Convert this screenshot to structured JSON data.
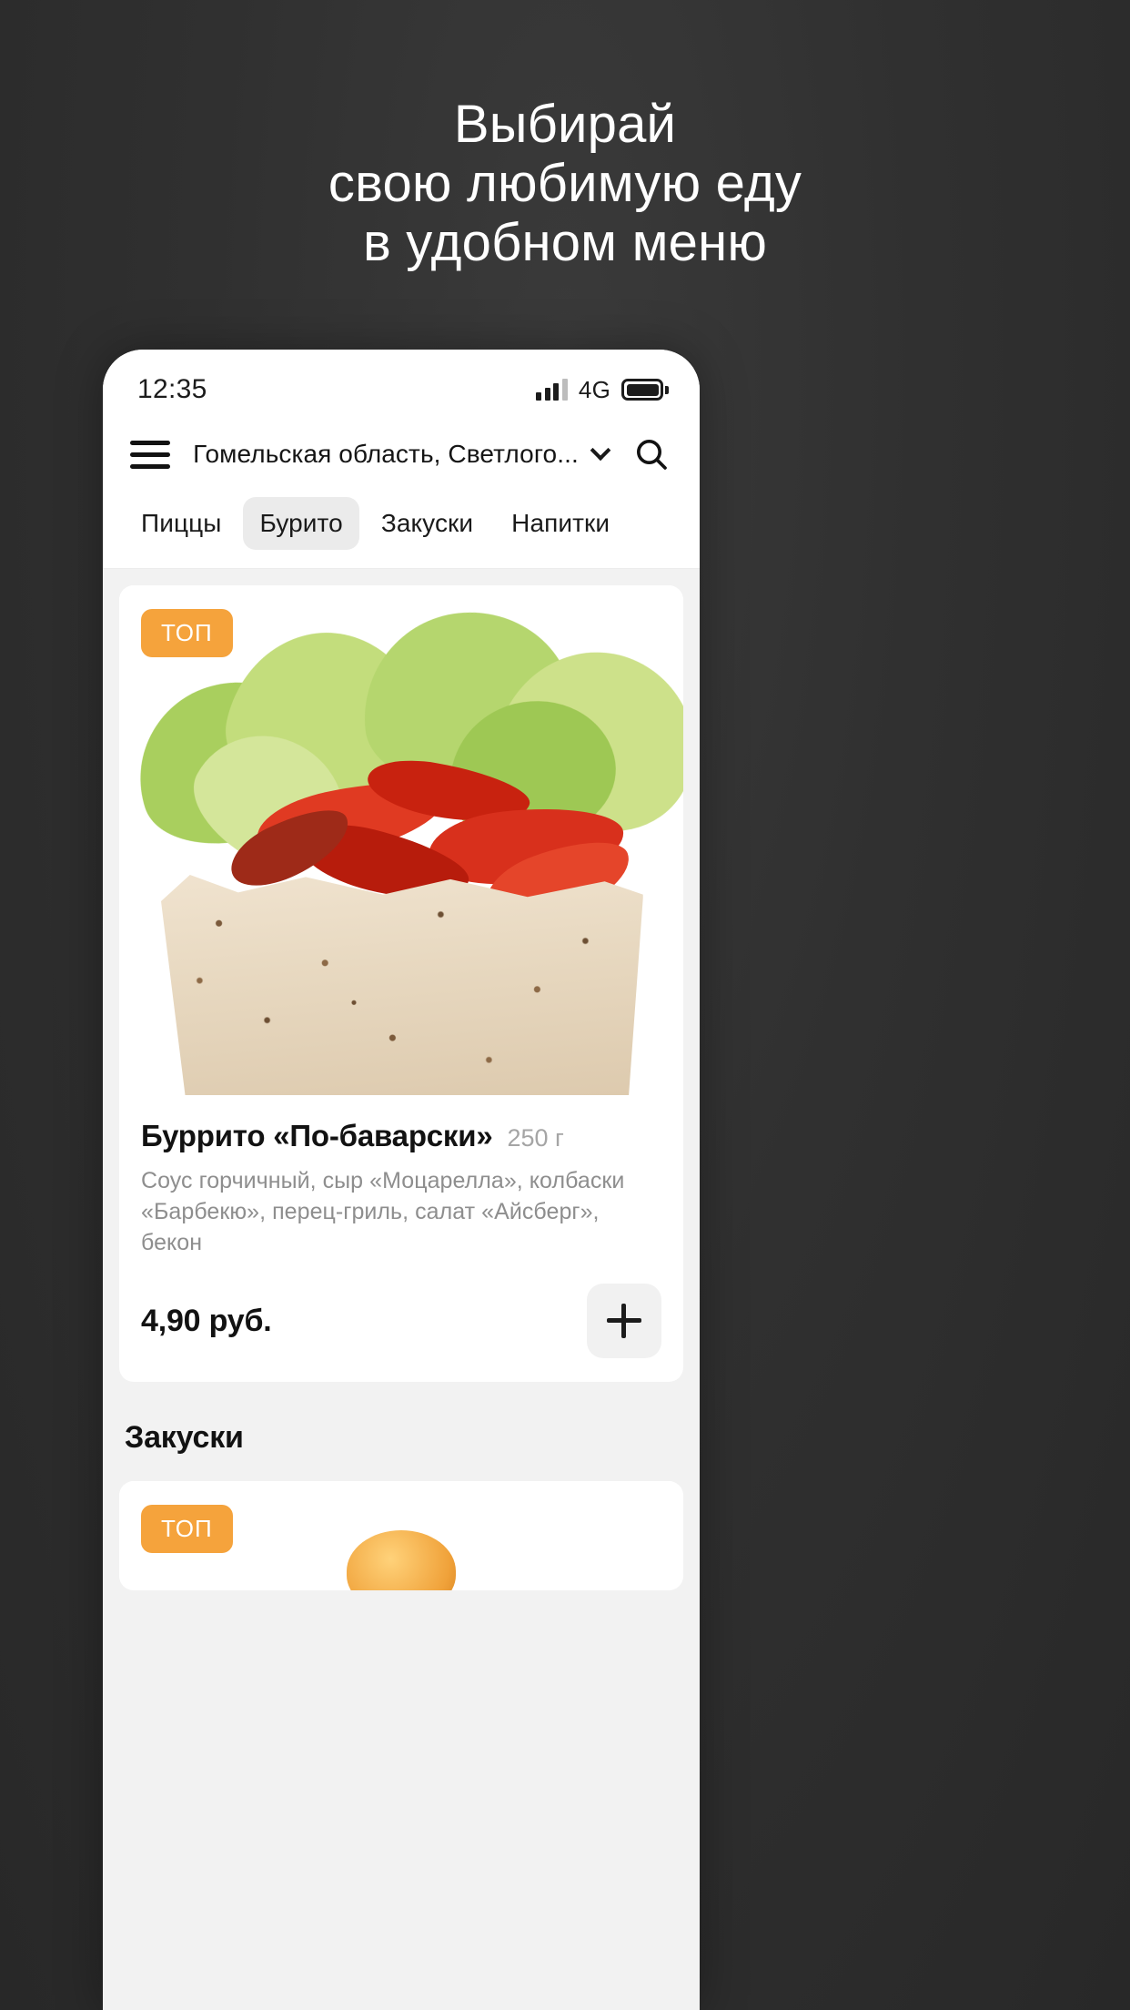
{
  "promo": {
    "headline_lines": [
      "Выбирай",
      "свою любимую еду",
      "в удобном меню"
    ],
    "background_color": "#2e2e2e",
    "text_color": "#ffffff"
  },
  "status_bar": {
    "time": "12:35",
    "network": "4G",
    "signal_bars_filled": 3,
    "signal_bars_total": 4,
    "battery_level": "full"
  },
  "app_header": {
    "menu_icon": "hamburger-icon",
    "location": "Гомельская область, Светлого...",
    "location_chevron": "chevron-down-icon",
    "search_icon": "search-icon"
  },
  "tabs": [
    {
      "label": "Пиццы",
      "active": false
    },
    {
      "label": "Бурито",
      "active": true
    },
    {
      "label": "Закуски",
      "active": false
    },
    {
      "label": "Напитки",
      "active": false
    }
  ],
  "products": [
    {
      "badge": "ТОП",
      "badge_color": "#f5a33c",
      "title": "Буррито «По-баварски»",
      "weight": "250 г",
      "description": "Соус горчичный, сыр «Моцарелла», колбаски «Барбекю», перец-гриль, салат «Айсберг», бекон",
      "price": "4,90 руб.",
      "add_icon": "plus-icon"
    }
  ],
  "next_section": {
    "title": "Закуски",
    "first_card_badge": "ТОП"
  }
}
